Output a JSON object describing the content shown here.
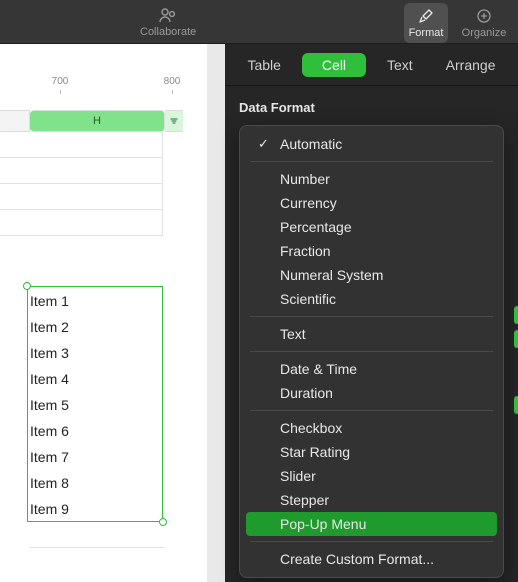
{
  "toolbar": {
    "collaborate": {
      "label": "Collaborate"
    },
    "format": {
      "label": "Format"
    },
    "organize": {
      "label": "Organize"
    }
  },
  "subtabs": {
    "table": "Table",
    "cell": "Cell",
    "text": "Text",
    "arrange": "Arrange",
    "active": "cell"
  },
  "ruler": {
    "ticks": [
      "700",
      "800"
    ]
  },
  "columns": {
    "selected": "H"
  },
  "selection": {
    "items": [
      "Item 1",
      "Item 2",
      "Item 3",
      "Item 4",
      "Item 5",
      "Item 6",
      "Item 7",
      "Item 8",
      "Item 9"
    ]
  },
  "inspector": {
    "section": "Data Format",
    "menu": {
      "checked": "Automatic",
      "groups": [
        [
          "Automatic"
        ],
        [
          "Number",
          "Currency",
          "Percentage",
          "Fraction",
          "Numeral System",
          "Scientific"
        ],
        [
          "Text"
        ],
        [
          "Date & Time",
          "Duration"
        ],
        [
          "Checkbox",
          "Star Rating",
          "Slider",
          "Stepper",
          "Pop-Up Menu"
        ],
        [
          "Create Custom Format..."
        ]
      ],
      "highlighted": "Pop-Up Menu"
    }
  },
  "colors": {
    "accent": "#2fbf3a"
  }
}
